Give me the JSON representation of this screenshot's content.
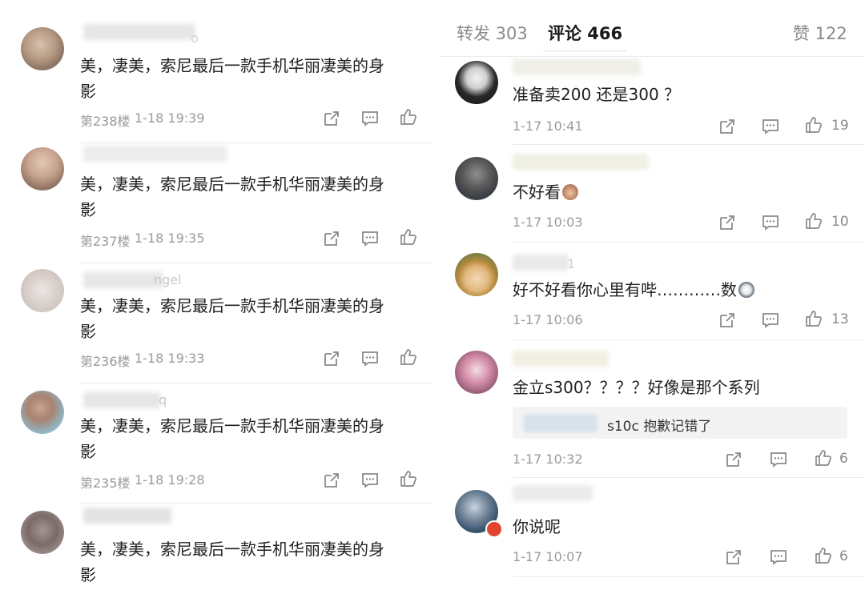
{
  "left": {
    "comments": [
      {
        "text": "美，凄美，索尼最后一款手机华丽凄美的身",
        "text2": "影",
        "floor": "第238楼",
        "time": "1-18 19:39"
      },
      {
        "text": "美，凄美，索尼最后一款手机华丽凄美的身",
        "text2": "影",
        "floor": "第237楼",
        "time": "1-18 19:35"
      },
      {
        "text": "美，凄美，索尼最后一款手机华丽凄美的身",
        "text2": "影",
        "floor": "第236楼",
        "time": "1-18 19:33"
      },
      {
        "text": "美，凄美，索尼最后一款手机华丽凄美的身",
        "text2": "影",
        "floor": "第235楼",
        "time": "1-18 19:28"
      },
      {
        "text": "美，凄美，索尼最后一款手机华丽凄美的身",
        "text2": "影"
      }
    ],
    "name_fragments": [
      "o",
      "ngel",
      "q"
    ]
  },
  "right": {
    "tabs": {
      "repost": "转发 303",
      "comments": "评论 466",
      "likes": "赞 122"
    },
    "comments": [
      {
        "text": "准备卖200 还是300 ？",
        "time": "1-17 10:41",
        "likes": "19"
      },
      {
        "text": "不好看",
        "time": "1-17 10:03",
        "likes": "10"
      },
      {
        "text": "好不好看你心里有哔…………数",
        "time": "1-17 10:06",
        "likes": "13"
      },
      {
        "text": "金立s300？？？？好像是那个系列",
        "reply": "s10c 抱歉记错了",
        "time": "1-17 10:32",
        "likes": "6"
      },
      {
        "text": "你说呢",
        "time": "1-17 10:07",
        "likes": "6"
      }
    ],
    "name_fragments": [
      "1"
    ]
  },
  "icons": {
    "share": "share-icon",
    "comment": "comment-icon",
    "like": "thumbs-up-icon"
  },
  "colors": {
    "text": "#1f1f1f",
    "meta": "#9a9a9a",
    "icon": "#8a8a8a"
  }
}
